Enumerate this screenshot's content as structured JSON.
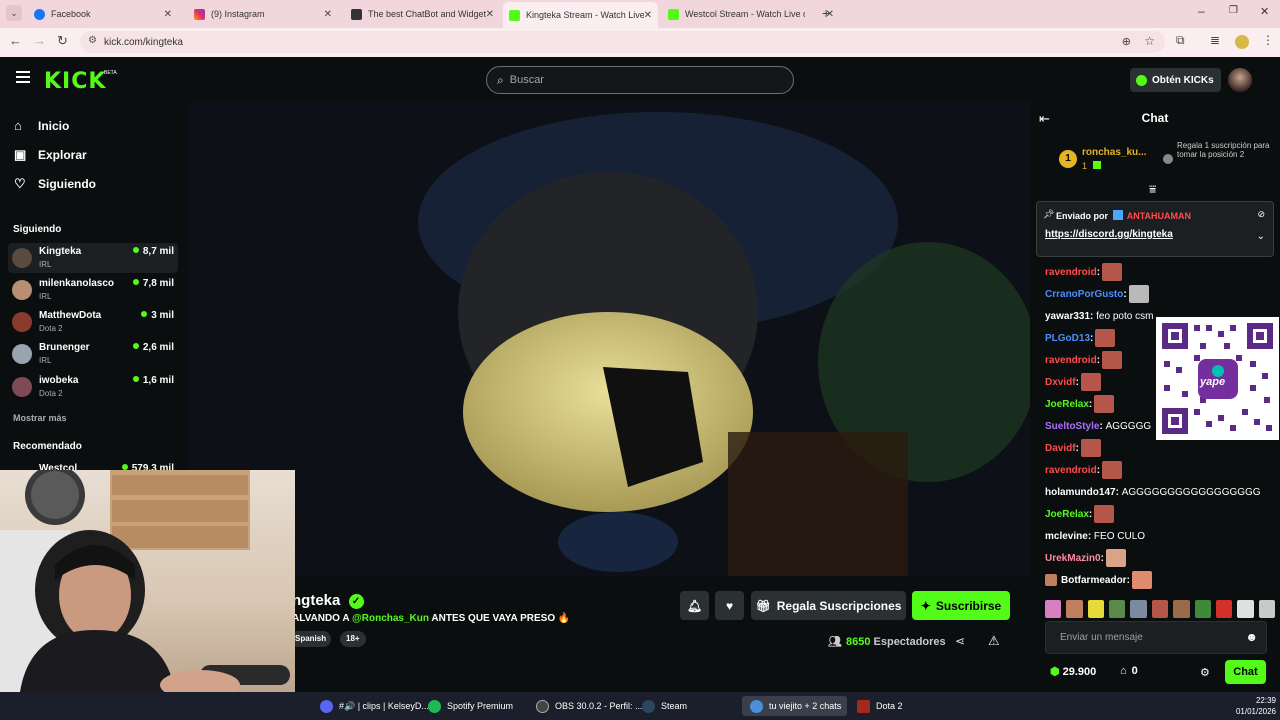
{
  "browser": {
    "tabs": [
      {
        "title": "Facebook",
        "color": "#1877f2"
      },
      {
        "title": "(9) Instagram",
        "color": "#e1306c"
      },
      {
        "title": "The best ChatBot and Widgets",
        "color": "#333333"
      },
      {
        "title": "Kingteka Stream - Watch Live o",
        "color": "#53fc18"
      },
      {
        "title": "Westcol Stream - Watch Live o",
        "color": "#53fc18"
      }
    ],
    "url": "kick.com/kingteka"
  },
  "header": {
    "logo": "KICK",
    "logo_badge": "BETA",
    "search_placeholder": "Buscar",
    "kicks_button": "Obtén KICKs"
  },
  "sidebar": {
    "nav": [
      {
        "label": "Inicio",
        "icon": "home-icon"
      },
      {
        "label": "Explorar",
        "icon": "compass-icon"
      },
      {
        "label": "Siguiendo",
        "icon": "heart-icon"
      }
    ],
    "following_title": "Siguiendo",
    "following": [
      {
        "name": "Kingteka",
        "category": "IRL",
        "viewers": "8,7 mil",
        "color": "#5a4a3f"
      },
      {
        "name": "milenkanolasco",
        "category": "IRL",
        "viewers": "7,8 mil",
        "color": "#b98f74"
      },
      {
        "name": "MatthewDota",
        "category": "Dota 2",
        "viewers": "3 mil",
        "color": "#8a3b2e"
      },
      {
        "name": "Brunenger",
        "category": "IRL",
        "viewers": "2,6 mil",
        "color": "#9aa3b0"
      },
      {
        "name": "iwobeka",
        "category": "Dota 2",
        "viewers": "1,6 mil",
        "color": "#7d4a55"
      }
    ],
    "show_more": "Mostrar más",
    "recommended_title": "Recomendado",
    "recommended": [
      {
        "name": "Westcol",
        "viewers": "579,3 mil"
      }
    ]
  },
  "stream": {
    "name": "ngteka",
    "title_prefix": "ALVANDO A ",
    "title_mention": "@Ronchas_Kun",
    "title_suffix": " ANTES QUE VAYA PRESO 🔥",
    "tags": [
      "Spanish",
      "18+"
    ],
    "gift_button": "Regala Suscripciones",
    "subscribe_button": "Suscribirse",
    "viewers_count": "8650",
    "viewers_label": "Espectadores"
  },
  "chat": {
    "title": "Chat",
    "leader": {
      "rank": "1",
      "name": "ronchas_ku...",
      "count": "1",
      "note": "Regala 1 suscripción para tomar la posición 2"
    },
    "pinned": {
      "by_label": "Enviado por",
      "by_user": "ANTAHUAMAN",
      "link": "https://discord.gg/kingteka"
    },
    "messages": [
      {
        "user": "ravendroid",
        "color": "#ff4d4d",
        "text": "",
        "emote": "#b4574a"
      },
      {
        "user": "CrranoPorGusto",
        "color": "#4d8cff",
        "text": "",
        "emote": "#b9b9b9"
      },
      {
        "user": "yawar331",
        "color": "#ffffff",
        "text": "feo poto csm",
        "emote": ""
      },
      {
        "user": "PLGoD13",
        "color": "#4d8cff",
        "text": "",
        "emote": "#b4574a"
      },
      {
        "user": "ravendroid",
        "color": "#ff4d4d",
        "text": "",
        "emote": "#b4574a"
      },
      {
        "user": "Dxvidf",
        "color": "#ff4d4d",
        "text": "",
        "emote": "#b4574a"
      },
      {
        "user": "JoeRelax",
        "color": "#53fc18",
        "text": "",
        "emote": "#b4574a"
      },
      {
        "user": "SueltoStyle",
        "color": "#a970ff",
        "text": "AGGGGG",
        "emote": ""
      },
      {
        "user": "Davidf",
        "color": "#ff4d4d",
        "text": "",
        "emote": "#b4574a"
      },
      {
        "user": "ravendroid",
        "color": "#ff4d4d",
        "text": "",
        "emote": "#b4574a"
      },
      {
        "user": "holamundo147",
        "color": "#ffffff",
        "text": "AGGGGGGGGGGGGGGGGG",
        "emote": ""
      },
      {
        "user": "JoeRelax",
        "color": "#53fc18",
        "text": "",
        "emote": "#b4574a"
      },
      {
        "user": "mclevine",
        "color": "#ffffff",
        "text": "FEO CULO",
        "emote": ""
      },
      {
        "user": "UrekMazin0",
        "color": "#ff8aa0",
        "text": "",
        "emote": "#d9a38a"
      },
      {
        "user": "Botfarmeador",
        "color": "#ffffff",
        "text": "",
        "emote": "#e08a70"
      }
    ],
    "input_placeholder": "Enviar un mensaje",
    "points": "29.900",
    "gifts": "0",
    "send_button": "Chat",
    "qr_label": "yape"
  },
  "taskbar": {
    "items": [
      {
        "label": "#🔊 | clips | KelseyD...",
        "color": "#5865f2"
      },
      {
        "label": "Spotify Premium",
        "color": "#1db954"
      },
      {
        "label": "OBS 30.0.2 - Perfil: ...",
        "color": "#444444"
      },
      {
        "label": "Steam",
        "color": "#1b2838"
      },
      {
        "label": "tu viejito + 2 chats",
        "color": "#4a90d9"
      },
      {
        "label": "Dota 2",
        "color": "#a32a1e"
      }
    ],
    "time": "22:39",
    "date": "01/01/2026"
  }
}
